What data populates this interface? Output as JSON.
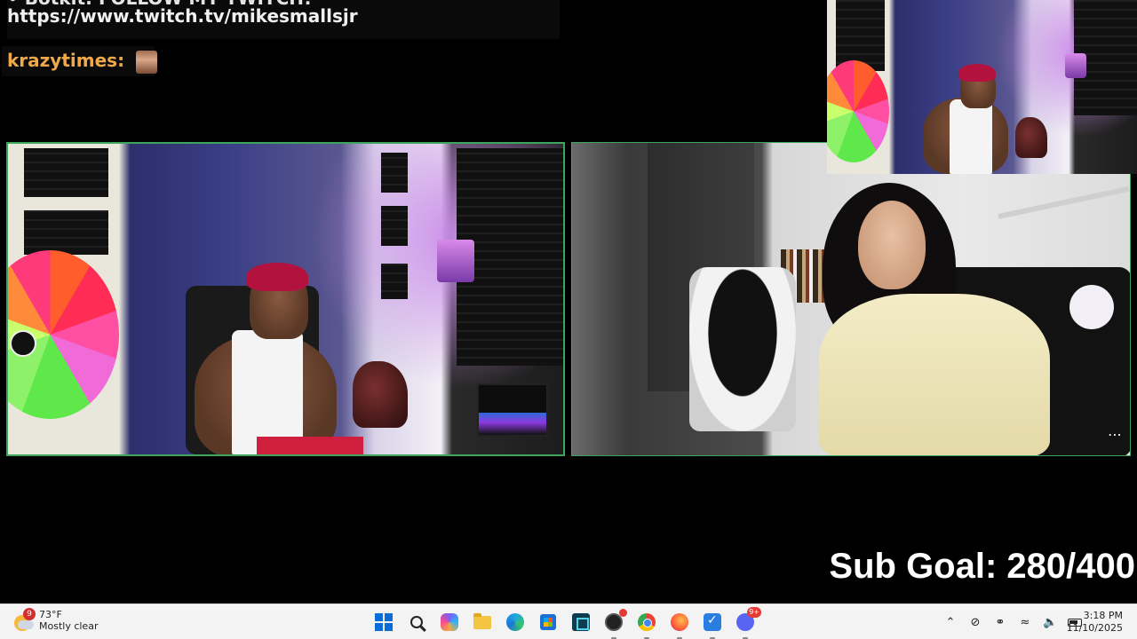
{
  "chat": {
    "partial_line": "• Botkit: FOLLOW MY TWITCH!",
    "url_line": "https://www.twitch.tv/mikesmallsjr",
    "second_user": "krazytimes:"
  },
  "overlay": {
    "sub_goal": "Sub Goal: 280/400"
  },
  "streams": {
    "left": "stream-mikesmallsjr",
    "right": "stream-guest",
    "pip": "stream-mikesmallsjr-pip"
  },
  "taskbar": {
    "weather": {
      "temp": "73°F",
      "condition": "Mostly clear",
      "badge": "9"
    },
    "apps": [
      "start",
      "search",
      "copilot",
      "file-explorer",
      "edge",
      "microsoft-store",
      "app",
      "obs",
      "chrome",
      "firefox",
      "todo",
      "discord"
    ],
    "discord_badge": "9+",
    "clock": {
      "time": "3:18 PM",
      "date": "11/10/2025"
    }
  },
  "colors": {
    "frame_border": "#3ba55c",
    "chat_username": "#f0a94a",
    "taskbar_bg": "#f3f3f3"
  }
}
